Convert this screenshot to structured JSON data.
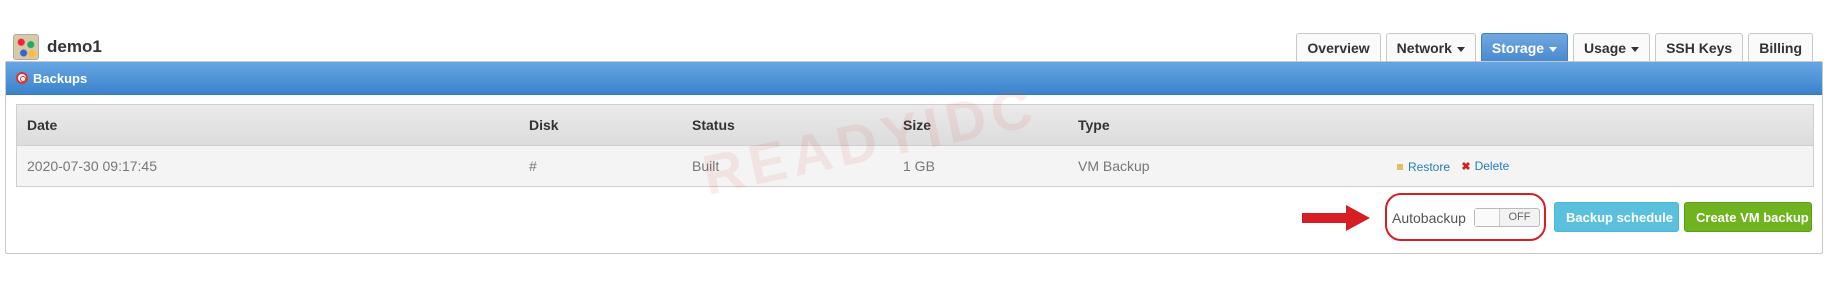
{
  "vm": {
    "name": "demo1"
  },
  "tabs": [
    {
      "label": "Overview",
      "dropdown": false,
      "active": false
    },
    {
      "label": "Network",
      "dropdown": true,
      "active": false
    },
    {
      "label": "Storage",
      "dropdown": true,
      "active": true
    },
    {
      "label": "Usage",
      "dropdown": true,
      "active": false
    },
    {
      "label": "SSH Keys",
      "dropdown": false,
      "active": false
    },
    {
      "label": "Billing",
      "dropdown": false,
      "active": false
    }
  ],
  "panel": {
    "title": "Backups",
    "icon": "lifebuoy-icon"
  },
  "table": {
    "headers": [
      "Date",
      "Disk",
      "Status",
      "Size",
      "Type"
    ],
    "rows": [
      {
        "date": "2020-07-30 09:17:45",
        "disk": "#",
        "status": "Built",
        "size": "1 GB",
        "type": "VM Backup",
        "restore": "Restore",
        "delete": "Delete"
      }
    ]
  },
  "watermark": "READYIDC",
  "autobackup": {
    "label": "Autobackup",
    "state": "OFF"
  },
  "buttons": {
    "schedule": "Backup schedule",
    "create": "Create VM backup"
  },
  "colors": {
    "accent": "#4a8ad0",
    "annotation": "#d81e25",
    "schedule": "#5bc0de",
    "create": "#6fb31f"
  }
}
